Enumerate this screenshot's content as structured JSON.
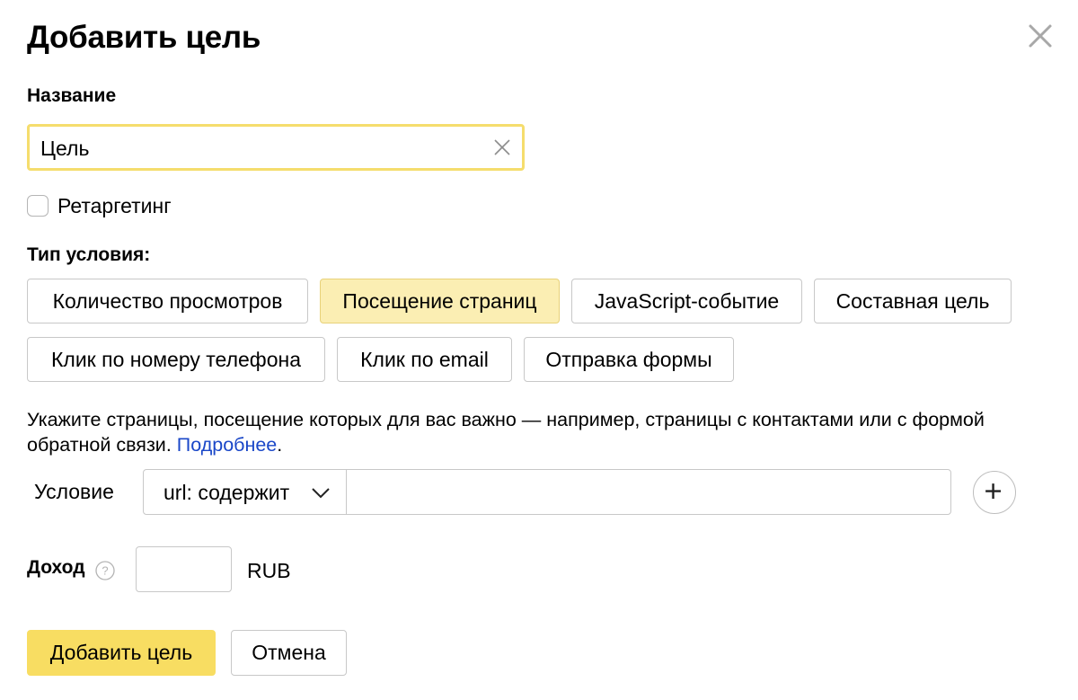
{
  "dialog": {
    "title": "Добавить цель",
    "close_icon": "close-icon"
  },
  "name_field": {
    "label": "Название",
    "value": "Цель",
    "clear_icon": "clear-icon"
  },
  "retargeting": {
    "label": "Ретаргетинг",
    "checked": false
  },
  "condition_type": {
    "label": "Тип условия:",
    "options": [
      "Количество просмотров",
      "Посещение страниц",
      "JavaScript-событие",
      "Составная цель",
      "Клик по номеру телефона",
      "Клик по email",
      "Отправка формы"
    ],
    "selected": "Посещение страниц"
  },
  "description": {
    "text": "Укажите страницы, посещение которых для вас важно — например, страницы с контактами или с формой обратной связи. ",
    "link_text": "Подробнее",
    "trailing": "."
  },
  "condition": {
    "label": "Условие",
    "select_value": "url: содержит",
    "input_value": "",
    "add_icon": "plus-icon"
  },
  "income": {
    "label": "Доход",
    "help_icon": "question-icon",
    "value": "",
    "currency": "RUB"
  },
  "actions": {
    "submit_label": "Добавить цель",
    "cancel_label": "Отмена"
  },
  "colors": {
    "accent": "#f8dd62",
    "selected_chip": "#fbeeb3",
    "focus_border": "#f5dd6d",
    "link": "#1a47c8"
  }
}
